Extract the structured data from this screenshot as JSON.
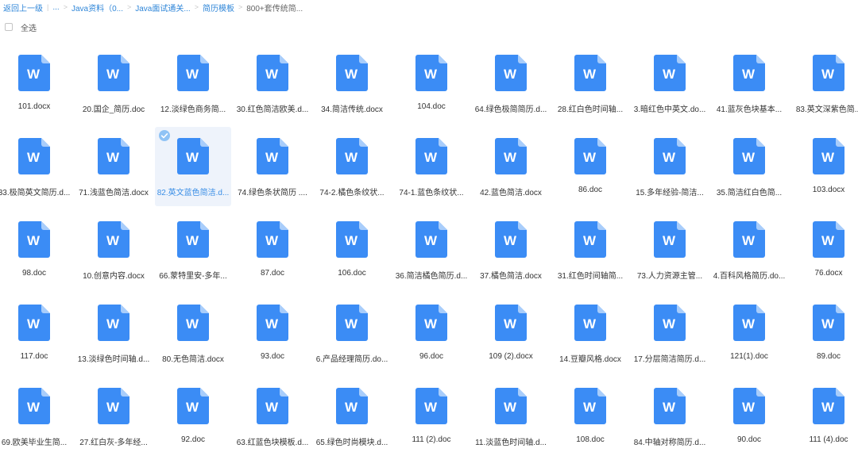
{
  "breadcrumb": {
    "items": [
      "返回上一级",
      "...",
      "Java资料（0...",
      "Java面试通关...",
      "简历模板",
      "800+套传统简..."
    ],
    "separators": [
      "|",
      ">",
      ">",
      ">",
      ">"
    ]
  },
  "toolbar": {
    "select_all_label": "全选"
  },
  "colors": {
    "accent": "#2f86d8",
    "doc_icon": "#3b8cf5",
    "doc_icon_fold": "#a8cdfb",
    "selected_bg": "#eef3fb"
  },
  "icons": {
    "file": "word-doc-icon",
    "selection": "checkmark-circle-icon"
  },
  "files": [
    "101.docx",
    "20.国企_简历.doc",
    "12.淡绿色商务简...",
    "30.红色简洁欧美.d...",
    "34.简洁传统.docx",
    "104.doc",
    "64.绿色极简简历.d...",
    "28.红白色时间轴...",
    "3.暗红色中英文.do...",
    "41.蓝灰色块基本...",
    "83.英文深紫色简...",
    "33.极简英文简历.d...",
    "71.浅蓝色简洁.docx",
    "82.英文蓝色简洁.d...",
    "74.绿色条状简历 ....",
    "74-2.橘色条纹状...",
    "74-1.蓝色条纹状...",
    "42.蓝色简洁.docx",
    "86.doc",
    "15.多年经验-简洁...",
    "35.简洁红白色简...",
    "103.docx",
    "98.doc",
    "10.创意内容.docx",
    "66.蒙特里安-多年...",
    "87.doc",
    "106.doc",
    "36.简洁橘色简历.d...",
    "37.橘色简洁.docx",
    "31.红色时间轴简...",
    "73.人力资源主管...",
    "4.百科风格简历.do...",
    "76.docx",
    "117.doc",
    "13.淡绿色时间轴.d...",
    "80.无色简洁.docx",
    "93.doc",
    "6.产品经理简历.do...",
    "96.doc",
    "109 (2).docx",
    "14.豆瓣风格.docx",
    "17.分层简洁简历.d...",
    "121(1).doc",
    "89.doc",
    "69.欧美毕业生简...",
    "27.红白灰-多年经...",
    "92.doc",
    "63.红蓝色块模板.d...",
    "65.绿色时尚模块.d...",
    "111 (2).doc",
    "11.淡蓝色时间轴.d...",
    "108.doc",
    "84.中轴对称简历.d...",
    "90.doc",
    "111 (4).doc"
  ],
  "selected_index": 13,
  "icon_letter": "W"
}
